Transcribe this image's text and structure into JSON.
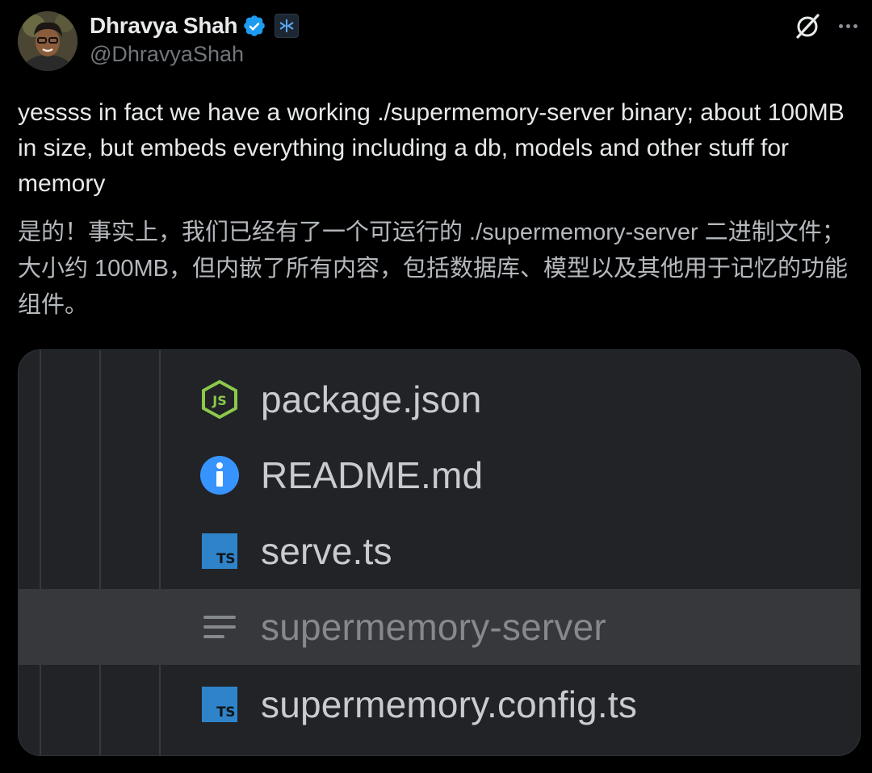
{
  "author": {
    "display_name": "Dhravya Shah",
    "handle": "@DhravyaShah",
    "verified_icon": "verified-badge-icon",
    "affiliate_icon": "affiliate-badge-icon"
  },
  "actions": {
    "grok_icon": "grok-icon",
    "more_icon": "more-options-icon"
  },
  "tweet": {
    "text": "yessss in fact we have a working ./supermemory-server binary; about 100MB in size, but embeds everything including a db, models and other stuff for memory",
    "translation": "是的！事实上，我们已经有了一个可运行的 ./supermemory-server 二进制文件；大小约 100MB，但内嵌了所有内容，包括数据库、模型以及其他用于记忆的功能组件。"
  },
  "media": {
    "files": [
      {
        "name": "package.json",
        "icon": "nodejs-icon",
        "selected": false
      },
      {
        "name": "README.md",
        "icon": "info-icon",
        "selected": false
      },
      {
        "name": "serve.ts",
        "icon": "typescript-icon",
        "selected": false
      },
      {
        "name": "supermemory-server",
        "icon": "text-file-icon",
        "selected": true
      },
      {
        "name": "supermemory.config.ts",
        "icon": "typescript-icon",
        "selected": false
      }
    ],
    "ts_label": "TS",
    "js_label": "JS"
  },
  "colors": {
    "background": "#000000",
    "verified": "#1d9bf0",
    "ts_blue": "#2f84c9",
    "node_green": "#8cc84b",
    "info_blue": "#3794ff"
  }
}
